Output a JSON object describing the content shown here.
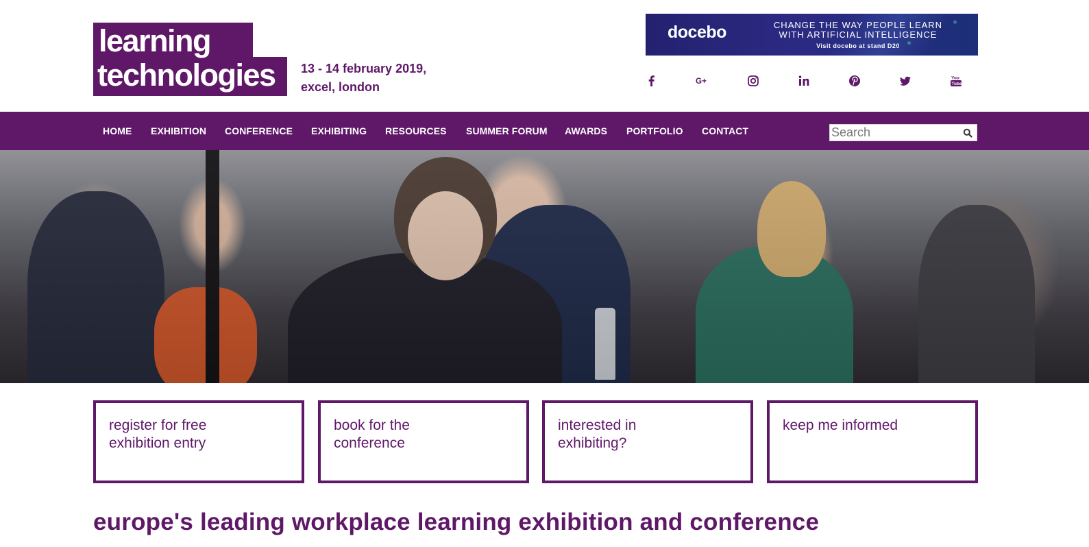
{
  "logo": {
    "line1": "learning",
    "line2": "technologies"
  },
  "event": {
    "date_line1": "13 - 14 february 2019,",
    "date_line2": "excel, london"
  },
  "banner": {
    "brand": "docebo",
    "tagline_line1": "CHANGE THE WAY PEOPLE LEARN",
    "tagline_line2": "WITH ARTIFICIAL INTELLIGENCE",
    "subtext": "Visit docebo at stand D20"
  },
  "social": {
    "icons": [
      "facebook-icon",
      "google-plus-icon",
      "instagram-icon",
      "linkedin-icon",
      "pinterest-icon",
      "twitter-icon",
      "youtube-icon"
    ],
    "color": "#5f1868"
  },
  "nav": {
    "items": [
      {
        "label": "HOME"
      },
      {
        "label": "EXHIBITION"
      },
      {
        "label": "CONFERENCE"
      },
      {
        "label": "EXHIBITING"
      },
      {
        "label": "RESOURCES"
      },
      {
        "label": "SUMMER FORUM"
      },
      {
        "label": "AWARDS"
      },
      {
        "label": "PORTFOLIO"
      },
      {
        "label": "CONTACT"
      }
    ]
  },
  "search": {
    "placeholder": "Search",
    "value": ""
  },
  "cta": [
    {
      "label": "register for free exhibition entry"
    },
    {
      "label": "book for the conference"
    },
    {
      "label": "interested in exhibiting?"
    },
    {
      "label": "keep me informed"
    }
  ],
  "headline": "europe's leading workplace learning exhibition and conference",
  "colors": {
    "brand": "#5f1868",
    "nav_bg": "#5f1868",
    "text_on_brand": "#ffffff"
  }
}
